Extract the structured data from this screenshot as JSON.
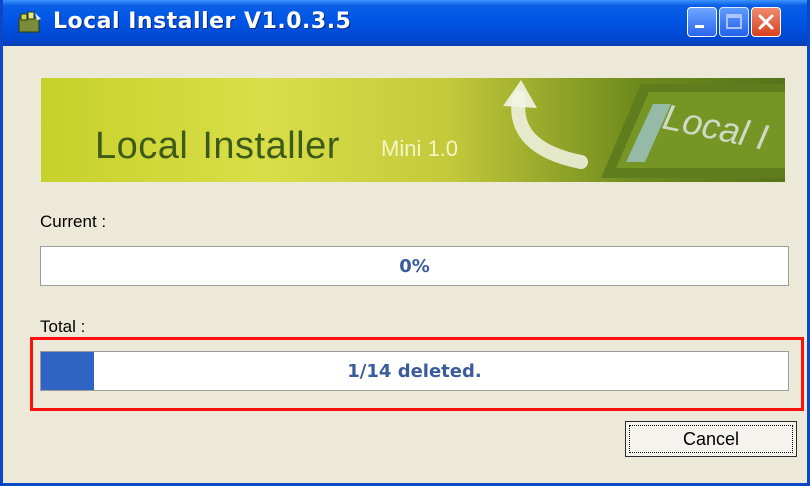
{
  "window": {
    "title": "Local Installer V1.0.3.5",
    "app_icon": "installer-app-icon",
    "controls": [
      "minimize-icon",
      "maximize-icon",
      "close-icon"
    ]
  },
  "banner": {
    "title": "Local  Installer",
    "title_part1": "Local",
    "title_part2": "Installer",
    "subtitle": "Mini 1.0",
    "logo_text": "Local I"
  },
  "current": {
    "label": "Current :",
    "progress_text": "0%",
    "progress": 0
  },
  "total": {
    "label": "Total :",
    "progress_text": "1/14 deleted.",
    "progress": 0.0714
  },
  "buttons": {
    "cancel_label": "Cancel"
  },
  "colors": {
    "titlebar": "#0055e5",
    "progress_fill": "#2f63c4",
    "highlight": "#ff1010"
  }
}
